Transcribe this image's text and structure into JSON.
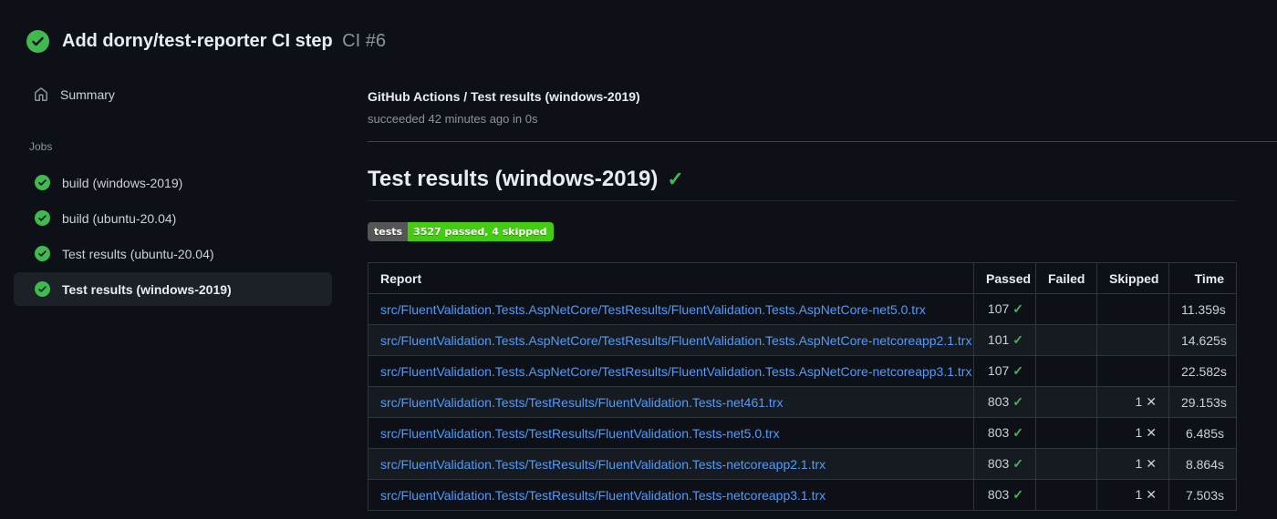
{
  "colors": {
    "background": "#0d1117",
    "success_green": "#3fb950",
    "link_blue": "#539bf5",
    "muted_text": "#8b949e",
    "badge_label_bg": "#555555",
    "badge_value_bg": "#44cc11",
    "selected_item_bg": "#1c2128"
  },
  "header": {
    "title": "Add dorny/test-reporter CI step",
    "run_ref": "CI #6",
    "status": "success"
  },
  "sidebar": {
    "summary_label": "Summary",
    "jobs_label": "Jobs",
    "jobs": [
      {
        "label": "build (windows-2019)",
        "status": "success",
        "selected": false
      },
      {
        "label": "build (ubuntu-20.04)",
        "status": "success",
        "selected": false
      },
      {
        "label": "Test results (ubuntu-20.04)",
        "status": "success",
        "selected": false
      },
      {
        "label": "Test results (windows-2019)",
        "status": "success",
        "selected": true
      }
    ]
  },
  "main": {
    "breadcrumb": "GitHub Actions / Test results (windows-2019)",
    "status_line": "succeeded 42 minutes ago in 0s",
    "heading": "Test results (windows-2019)",
    "heading_check": "✓",
    "badge": {
      "label": "tests",
      "value": "3527 passed, 4 skipped"
    },
    "table": {
      "headers": [
        "Report",
        "Passed",
        "Failed",
        "Skipped",
        "Time"
      ],
      "passed_mark": "✓",
      "skipped_mark": "✕",
      "rows": [
        {
          "report": "src/FluentValidation.Tests.AspNetCore/TestResults/FluentValidation.Tests.AspNetCore-net5.0.trx",
          "passed": "107",
          "failed": "",
          "skipped": "",
          "time": "11.359s"
        },
        {
          "report": "src/FluentValidation.Tests.AspNetCore/TestResults/FluentValidation.Tests.AspNetCore-netcoreapp2.1.trx",
          "passed": "101",
          "failed": "",
          "skipped": "",
          "time": "14.625s"
        },
        {
          "report": "src/FluentValidation.Tests.AspNetCore/TestResults/FluentValidation.Tests.AspNetCore-netcoreapp3.1.trx",
          "passed": "107",
          "failed": "",
          "skipped": "",
          "time": "22.582s"
        },
        {
          "report": "src/FluentValidation.Tests/TestResults/FluentValidation.Tests-net461.trx",
          "passed": "803",
          "failed": "",
          "skipped": "1",
          "time": "29.153s"
        },
        {
          "report": "src/FluentValidation.Tests/TestResults/FluentValidation.Tests-net5.0.trx",
          "passed": "803",
          "failed": "",
          "skipped": "1",
          "time": "6.485s"
        },
        {
          "report": "src/FluentValidation.Tests/TestResults/FluentValidation.Tests-netcoreapp2.1.trx",
          "passed": "803",
          "failed": "",
          "skipped": "1",
          "time": "8.864s"
        },
        {
          "report": "src/FluentValidation.Tests/TestResults/FluentValidation.Tests-netcoreapp3.1.trx",
          "passed": "803",
          "failed": "",
          "skipped": "1",
          "time": "7.503s"
        }
      ]
    }
  }
}
